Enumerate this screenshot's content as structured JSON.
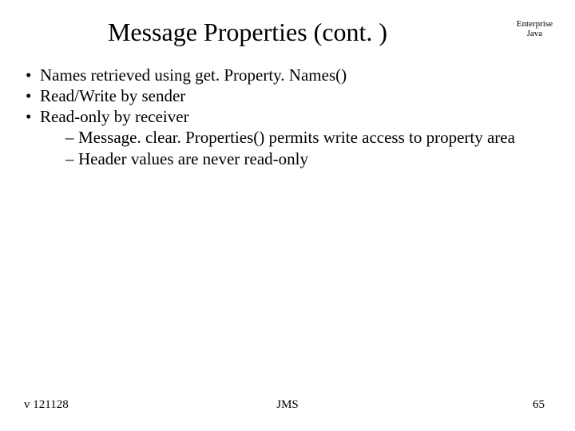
{
  "title": "Message Properties (cont. )",
  "corner": {
    "line1": "Enterprise",
    "line2": "Java"
  },
  "bullets": [
    "Names retrieved using get. Property. Names()",
    "Read/Write by sender",
    "Read-only by receiver"
  ],
  "sub_bullets": [
    "Message. clear. Properties() permits write access to property area",
    "Header values are never read-only"
  ],
  "footer": {
    "left": "v 121128",
    "center": "JMS",
    "right": "65"
  }
}
